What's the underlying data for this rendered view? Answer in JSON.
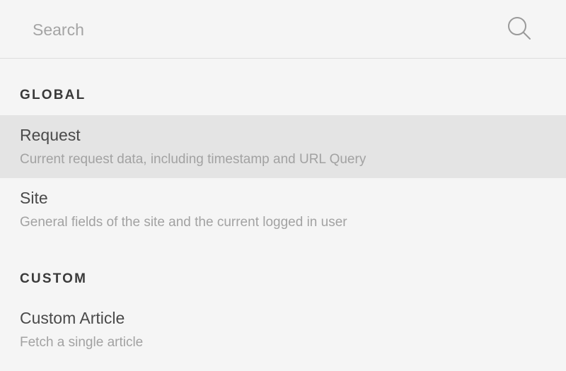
{
  "search": {
    "placeholder": "Search",
    "value": "",
    "icon": "search-icon"
  },
  "sections": [
    {
      "heading": "GLOBAL",
      "items": [
        {
          "title": "Request",
          "description": "Current request data, including timestamp and URL Query",
          "selected": true
        },
        {
          "title": "Site",
          "description": "General fields of the site and the current logged in user",
          "selected": false
        }
      ]
    },
    {
      "heading": "CUSTOM",
      "items": [
        {
          "title": "Custom Article",
          "description": "Fetch a single article",
          "selected": false
        }
      ]
    }
  ],
  "colors": {
    "background": "#f5f5f5",
    "selected_row": "#e4e4e4",
    "heading": "#3a3a3a",
    "title": "#4a4a4a",
    "description": "#a2a2a2"
  }
}
